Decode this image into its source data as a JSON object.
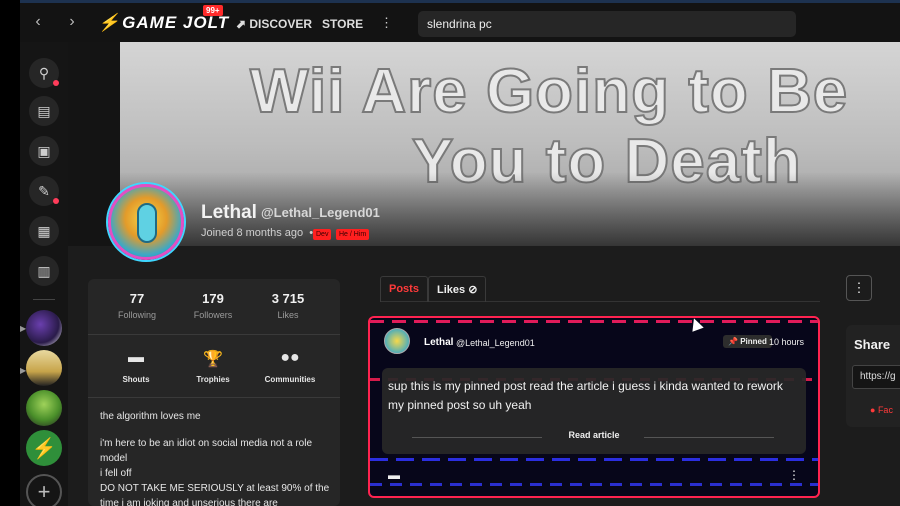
{
  "topbar": {
    "back_icon": "chevron-left-icon",
    "forward_icon": "chevron-right-icon",
    "logo": "GAME JOLT",
    "logo_badge": "99+",
    "discover_label": "DISCOVER",
    "store_label": "STORE",
    "search_value": "slendrina pc"
  },
  "sidebar": {
    "icons": [
      "activity-icon",
      "store-icon",
      "backpack-icon",
      "creator-icon",
      "chat-icon",
      "library-icon"
    ]
  },
  "banner": {
    "line1": "Wii Are Going to Be",
    "line2": "You to Death"
  },
  "profile": {
    "name": "Lethal",
    "handle": "@Lethal_Legend01",
    "joined": "Joined 8 months ago",
    "tags": [
      "Dev",
      "He / Him"
    ]
  },
  "stats": [
    {
      "num": "77",
      "label": "Following"
    },
    {
      "num": "179",
      "label": "Followers"
    },
    {
      "num": "3 715",
      "label": "Likes"
    }
  ],
  "sections": [
    {
      "label": "Shouts"
    },
    {
      "label": "Trophies"
    },
    {
      "label": "Communities"
    }
  ],
  "bio": {
    "line1": "the algorithm loves me",
    "line2": "i'm here to be an idiot on social media not a role model",
    "line3": "i fell off",
    "line4": "DO NOT TAKE ME SERIOUSLY at least 90% of the time i am joking and unserious there are"
  },
  "tabs": {
    "posts": "Posts",
    "likes": "Likes"
  },
  "post": {
    "name": "Lethal",
    "handle": "@Lethal_Legend01",
    "pinned": "Pinned",
    "time": "10 hours",
    "text": "sup this is my pinned post read the article i guess i kinda wanted to rework my pinned post so uh yeah",
    "read_article": "Read article"
  },
  "share": {
    "title": "Share",
    "url": "https://g",
    "facebook": "Fac"
  }
}
